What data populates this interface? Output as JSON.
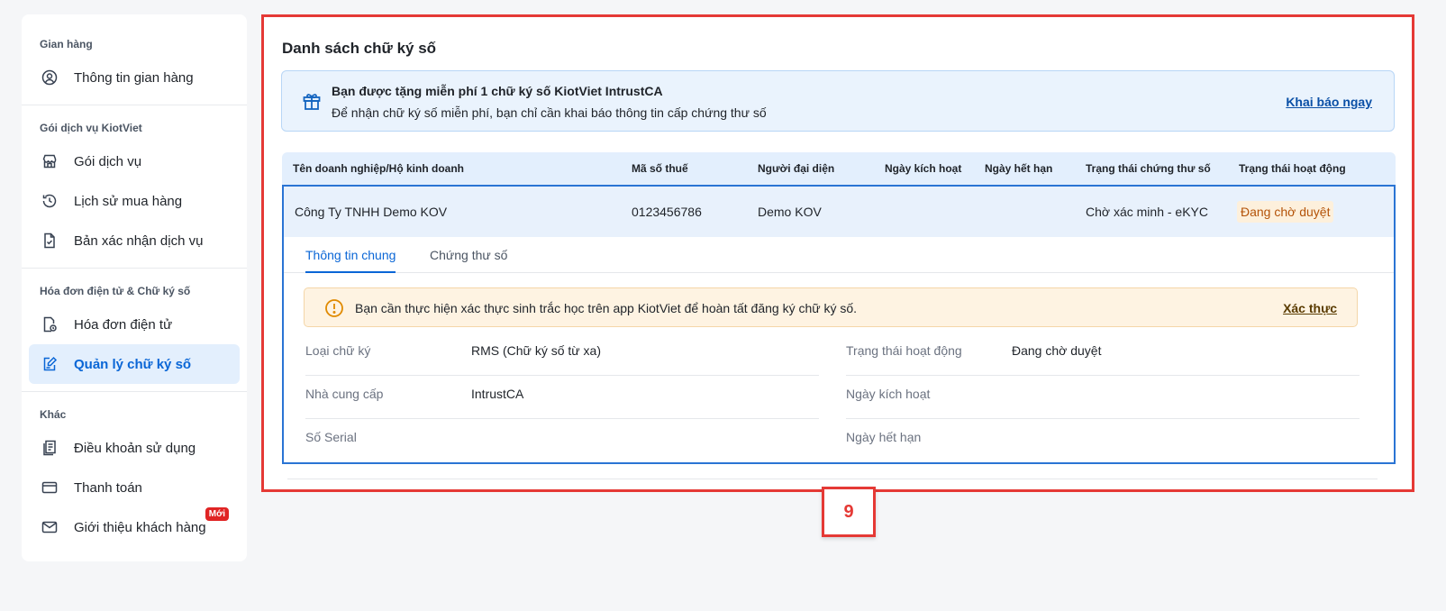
{
  "sidebar": {
    "groups": [
      {
        "title": "Gian hàng",
        "items": [
          {
            "label": "Thông tin gian hàng",
            "icon": "user-circle-icon"
          }
        ]
      },
      {
        "title": "Gói dịch vụ KiotViet",
        "items": [
          {
            "label": "Gói dịch vụ",
            "icon": "store-icon"
          },
          {
            "label": "Lịch sử mua hàng",
            "icon": "history-icon"
          },
          {
            "label": "Bản xác nhận dịch vụ",
            "icon": "document-check-icon"
          }
        ]
      },
      {
        "title": "Hóa đơn điện tử & Chữ ký số",
        "items": [
          {
            "label": "Hóa đơn điện tử",
            "icon": "invoice-icon"
          },
          {
            "label": "Quản lý chữ ký số",
            "icon": "signature-edit-icon",
            "active": true
          }
        ]
      },
      {
        "title": "Khác",
        "items": [
          {
            "label": "Điều khoản sử dụng",
            "icon": "terms-icon"
          },
          {
            "label": "Thanh toán",
            "icon": "wallet-icon"
          },
          {
            "label": "Giới thiệu khách hàng",
            "icon": "mail-icon",
            "badge": "Mới"
          }
        ]
      }
    ]
  },
  "main": {
    "title": "Danh sách chữ ký số",
    "promo": {
      "title": "Bạn được tặng miễn phí 1 chữ ký số KiotViet IntrustCA",
      "subtitle": "Để nhận chữ ký số miễn phí, bạn chỉ cần khai báo thông tin cấp chứng thư số",
      "link": "Khai báo ngay"
    },
    "table": {
      "headers": {
        "company": "Tên doanh nghiệp/Hộ kinh doanh",
        "tax": "Mã số thuế",
        "rep": "Người đại diện",
        "activated": "Ngày kích hoạt",
        "expired": "Ngày hết hạn",
        "cert_status": "Trạng thái chứng thư số",
        "op_status": "Trạng thái hoạt động"
      },
      "row": {
        "company": "Công Ty TNHH Demo KOV",
        "tax": "0123456786",
        "rep": "Demo KOV",
        "activated": "",
        "expired": "",
        "cert_status": "Chờ xác minh - eKYC",
        "op_status": "Đang chờ duyệt"
      }
    },
    "tabs": {
      "general": "Thông tin chung",
      "certificate": "Chứng thư số"
    },
    "warning": {
      "text": "Bạn cần thực hiện xác thực sinh trắc học trên app KiotViet để hoàn tất đăng ký chữ ký số.",
      "link": "Xác thực"
    },
    "info": {
      "left": [
        {
          "label": "Loại chữ ký",
          "value": "RMS (Chữ ký số từ xa)"
        },
        {
          "label": "Nhà cung cấp",
          "value": "IntrustCA"
        },
        {
          "label": "Số Serial",
          "value": ""
        }
      ],
      "right": [
        {
          "label": "Trạng thái hoạt động",
          "value": "Đang chờ duyệt"
        },
        {
          "label": "Ngày kích hoạt",
          "value": ""
        },
        {
          "label": "Ngày hết hạn",
          "value": ""
        }
      ]
    }
  },
  "step": "9",
  "colors": {
    "accent": "#0a66d6",
    "highlight_border": "#e53935",
    "pending": "#b45309"
  }
}
